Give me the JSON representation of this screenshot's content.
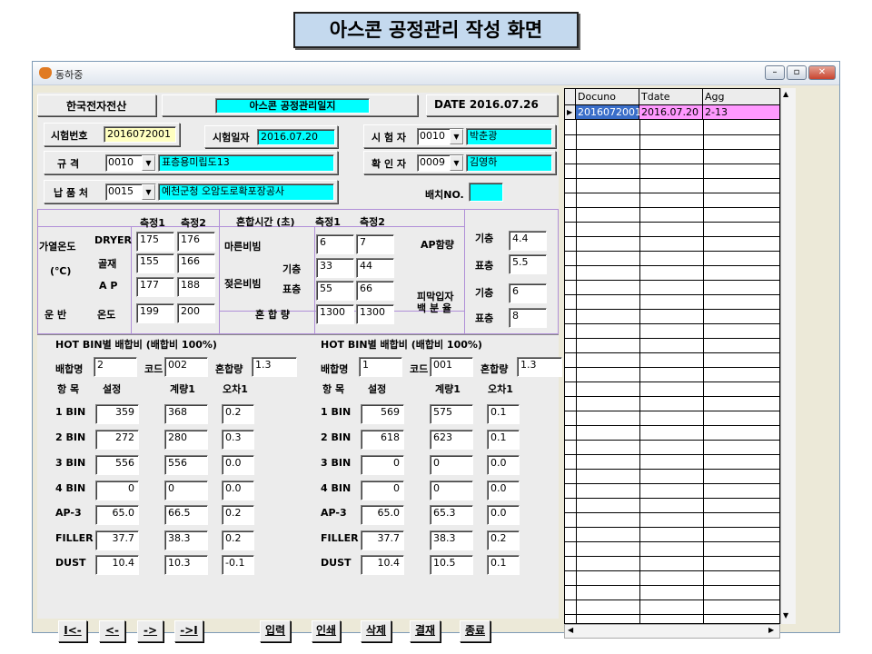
{
  "slide_title": "아스콘 공정관리 작성 화면",
  "window": {
    "title": "동하중",
    "min": "–",
    "max": "▫",
    "close": "✕"
  },
  "header": {
    "company": "한국전자전산",
    "doc_title": "아스콘 공정관리일지",
    "date": "DATE 2016.07.26"
  },
  "info": {
    "test_no_label": "시험번호",
    "test_no": "2016072001",
    "test_date_label": "시험일자",
    "test_date": "2016.07.20",
    "tester_label": "시 험 자",
    "tester_code": "0010",
    "tester_name": "박춘광",
    "spec_label": "규    격",
    "spec_code": "0010",
    "spec_name": "표층용미립도13",
    "checker_label": "확 인 자",
    "checker_code": "0009",
    "checker_name": "김영하",
    "supply_label": "납 품 처",
    "supply_code": "0015",
    "supply_name": "예천군청 오암도로확포장공사",
    "batch_label": "배치NO.",
    "batch_value": ""
  },
  "measure": {
    "m1": "측정1",
    "m2": "측정2",
    "mix_time": "혼합시간 (초)",
    "mix_m1": "측정1",
    "mix_m2": "측정2",
    "heat_temp": "가열온도",
    "unit_c": "(℃)",
    "dryer": "DRYER",
    "dryer1": "175",
    "dryer2": "176",
    "aggregate": "골재",
    "agg1": "155",
    "agg2": "166",
    "ap": "A P",
    "ap1": "177",
    "ap2": "188",
    "transport": "운  반",
    "temp": "온도",
    "temp1": "199",
    "temp2": "200",
    "dry_mix": "마른비빔",
    "dry1": "6",
    "dry2": "7",
    "wet_mix": "젖은비빔",
    "base": "기층",
    "surface": "표층",
    "wet_base1": "33",
    "wet_base2": "44",
    "wet_surf1": "55",
    "wet_surf2": "66",
    "mix_amount": "혼  합  량",
    "mix_amt1": "1300",
    "mix_amt2": "1300",
    "ap_content": "AP함량",
    "ap_base_lbl": "기층",
    "ap_base": "4.4",
    "ap_surf_lbl": "표층",
    "ap_surf": "5.5",
    "film_ratio": "피막입자\n백 분 율",
    "film_base_lbl": "기층",
    "film_base": "6",
    "film_surf_lbl": "표층",
    "film_surf": "8"
  },
  "hotbin_left": {
    "title": "HOT BIN별 배합비 (배합비 100%)",
    "mixname_label": "배합명",
    "mixname": "2",
    "code_label": "코드",
    "code": "002",
    "mixamt_label": "혼합량",
    "mixamt": "1.3",
    "col_item": "항 목",
    "col_set": "설정",
    "col_meas": "계량1",
    "col_err": "오차1",
    "rows": [
      {
        "item": "1 BIN",
        "set": "359",
        "meas": "368",
        "err": "0.2"
      },
      {
        "item": "2 BIN",
        "set": "272",
        "meas": "280",
        "err": "0.3"
      },
      {
        "item": "3 BIN",
        "set": "556",
        "meas": "556",
        "err": "0.0"
      },
      {
        "item": "4 BIN",
        "set": "0",
        "meas": "0",
        "err": "0.0"
      },
      {
        "item": "AP-3",
        "set": "65.0",
        "meas": "66.5",
        "err": "0.2"
      },
      {
        "item": "FILLER",
        "set": "37.7",
        "meas": "38.3",
        "err": "0.2"
      },
      {
        "item": "DUST",
        "set": "10.4",
        "meas": "10.3",
        "err": "-0.1"
      }
    ]
  },
  "hotbin_right": {
    "title": "HOT BIN별 배합비 (배합비 100%)",
    "mixname_label": "배합명",
    "mixname": "1",
    "code_label": "코드",
    "code": "001",
    "mixamt_label": "혼합량",
    "mixamt": "1.3",
    "col_item": "항 목",
    "col_set": "설정",
    "col_meas": "계량1",
    "col_err": "오차1",
    "rows": [
      {
        "item": "1 BIN",
        "set": "569",
        "meas": "575",
        "err": "0.1"
      },
      {
        "item": "2 BIN",
        "set": "618",
        "meas": "623",
        "err": "0.1"
      },
      {
        "item": "3 BIN",
        "set": "0",
        "meas": "0",
        "err": "0.0"
      },
      {
        "item": "4 BIN",
        "set": "0",
        "meas": "0",
        "err": "0.0"
      },
      {
        "item": "AP-3",
        "set": "65.0",
        "meas": "65.3",
        "err": "0.0"
      },
      {
        "item": "FILLER",
        "set": "37.7",
        "meas": "38.3",
        "err": "0.2"
      },
      {
        "item": "DUST",
        "set": "10.4",
        "meas": "10.5",
        "err": "0.1"
      }
    ]
  },
  "buttons": {
    "first": "I<-",
    "prev": "<-",
    "next": "->",
    "last": "->I",
    "input": "입력",
    "print": "인쇄",
    "delete": "삭제",
    "approve": "결재",
    "exit": "종료"
  },
  "grid": {
    "headers": [
      "Docuno",
      "Tdate",
      "Agg"
    ],
    "rows": [
      {
        "docuno": "2016072001",
        "tdate": "2016.07.20",
        "agg": "2-13"
      }
    ],
    "selected_color": "#ff99ff"
  }
}
